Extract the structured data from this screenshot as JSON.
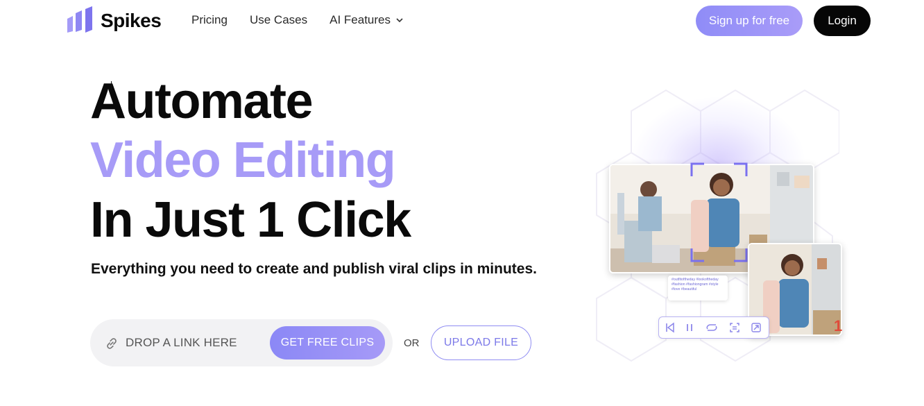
{
  "brand": {
    "name": "Spikes"
  },
  "nav": {
    "links": [
      {
        "label": "Pricing"
      },
      {
        "label": "Use Cases"
      },
      {
        "label": "AI Features"
      }
    ],
    "signup_label": "Sign up for free",
    "login_label": "Login"
  },
  "hero": {
    "line1": "Automate",
    "line2": "Video Editing",
    "line3": "In Just 1 Click",
    "subtitle": "Everything you need to create and publish viral clips in minutes."
  },
  "cta": {
    "link_placeholder": "DROP A LINK HERE",
    "get_clips_label": "GET FREE CLIPS",
    "or_label": "OR",
    "upload_label": "UPLOAD FILE"
  },
  "illustration": {
    "hashtags": "#outfitoftheday #lookoftheday #fashion #fashiongram #style #love #beautiful",
    "badge": "1"
  },
  "colors": {
    "accent": "#a79bf7",
    "button_gradient_start": "#8b88f6",
    "login_bg": "#060606"
  },
  "icons": {
    "logo": "spikes-bars-logo",
    "dropdown": "chevron-down-icon",
    "link": "link-icon",
    "player_controls": [
      "skip-back-icon",
      "pause-icon",
      "repeat-icon",
      "captions-icon",
      "share-icon"
    ]
  }
}
